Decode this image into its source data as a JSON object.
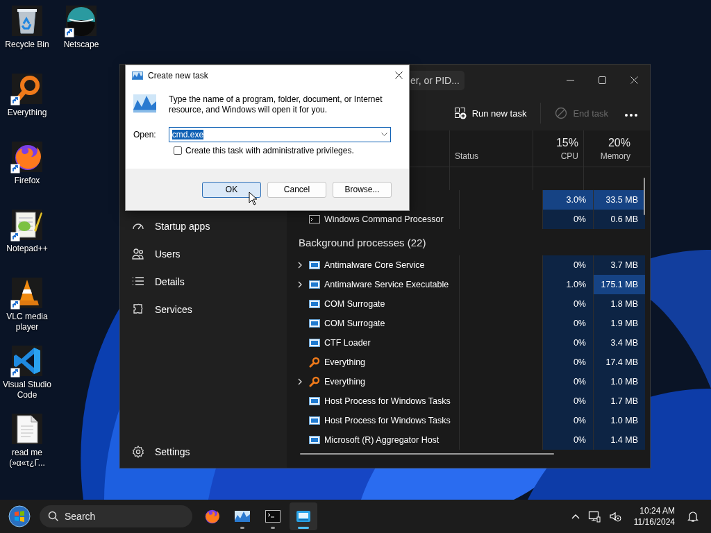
{
  "desktop": {
    "columns": [
      [
        {
          "label": "Recycle Bin",
          "kind": "recycle-bin",
          "shortcut": false
        },
        {
          "label": "Everything",
          "kind": "everything",
          "shortcut": true
        },
        {
          "label": "Firefox",
          "kind": "firefox",
          "shortcut": true
        },
        {
          "label": "Notepad++",
          "kind": "notepad",
          "shortcut": true
        },
        {
          "label": "VLC media player",
          "kind": "vlc",
          "shortcut": true
        },
        {
          "label": "Visual Studio Code",
          "kind": "vscode",
          "shortcut": true
        },
        {
          "label": "read me (»α«τ¿Γ...",
          "kind": "document",
          "shortcut": false
        }
      ],
      [
        {
          "label": "Netscape",
          "kind": "netscape",
          "shortcut": true
        }
      ]
    ]
  },
  "task_manager": {
    "search": {
      "placeholder": "er, or PID..."
    },
    "toolbar": [
      {
        "label": "Run new task",
        "kind": "run",
        "disabled": false
      },
      {
        "label": "End task",
        "kind": "end",
        "disabled": true
      }
    ],
    "sidebar": {
      "items": [
        {
          "label": "Startup apps",
          "kind": "startup"
        },
        {
          "label": "Users",
          "kind": "users"
        },
        {
          "label": "Details",
          "kind": "details"
        },
        {
          "label": "Services",
          "kind": "services"
        }
      ],
      "footer": {
        "label": "Settings",
        "kind": "settings"
      }
    },
    "columns": [
      {
        "kind": "status",
        "label": "Status"
      },
      {
        "kind": "cpu",
        "total": "15%",
        "label": "CPU"
      },
      {
        "kind": "memory",
        "total": "20%",
        "label": "Memory"
      }
    ],
    "apps_rows": [
      {
        "cpu": "3.0%",
        "memory": "33.5 MB",
        "cpu_hot": true,
        "memory_hot": true,
        "expandable": false
      },
      {
        "name": "Windows Command Processor",
        "kind": "console",
        "cpu": "0%",
        "memory": "0.6 MB",
        "cpu_hot": false,
        "memory_hot": false,
        "expandable": false
      }
    ],
    "background": {
      "title": "Background processes (22)",
      "rows": [
        {
          "name": "Antimalware Core Service",
          "kind": "service",
          "cpu": "0%",
          "memory": "3.7 MB",
          "cpu_hot": false,
          "memory_hot": false,
          "expandable": true
        },
        {
          "name": "Antimalware Service Executable",
          "kind": "service",
          "cpu": "1.0%",
          "memory": "175.1 MB",
          "cpu_hot": false,
          "memory_hot": true,
          "expandable": true
        },
        {
          "name": "COM Surrogate",
          "kind": "service",
          "cpu": "0%",
          "memory": "1.8 MB",
          "cpu_hot": false,
          "memory_hot": false,
          "expandable": false
        },
        {
          "name": "COM Surrogate",
          "kind": "service",
          "cpu": "0%",
          "memory": "1.9 MB",
          "cpu_hot": false,
          "memory_hot": false,
          "expandable": false
        },
        {
          "name": "CTF Loader",
          "kind": "service",
          "cpu": "0%",
          "memory": "3.4 MB",
          "cpu_hot": false,
          "memory_hot": false,
          "expandable": false
        },
        {
          "name": "Everything",
          "kind": "everything",
          "cpu": "0%",
          "memory": "17.4 MB",
          "cpu_hot": false,
          "memory_hot": false,
          "expandable": false
        },
        {
          "name": "Everything",
          "kind": "everything",
          "cpu": "0%",
          "memory": "1.0 MB",
          "cpu_hot": false,
          "memory_hot": false,
          "expandable": true
        },
        {
          "name": "Host Process for Windows Tasks",
          "kind": "service",
          "cpu": "0%",
          "memory": "1.7 MB",
          "cpu_hot": false,
          "memory_hot": false,
          "expandable": false
        },
        {
          "name": "Host Process for Windows Tasks",
          "kind": "service",
          "cpu": "0%",
          "memory": "1.0 MB",
          "cpu_hot": false,
          "memory_hot": false,
          "expandable": false
        },
        {
          "name": "Microsoft (R) Aggregator Host",
          "kind": "service",
          "cpu": "0%",
          "memory": "1.4 MB",
          "cpu_hot": false,
          "memory_hot": false,
          "expandable": false
        }
      ]
    }
  },
  "dialog": {
    "title": "Create new task",
    "message": "Type the name of a program, folder, document, or Internet resource, and Windows will open it for you.",
    "open_label": "Open:",
    "value": "cmd.exe",
    "value_selected": true,
    "checkbox": {
      "label": "Create this task with administrative privileges.",
      "checked": false
    },
    "buttons": [
      {
        "label": "OK",
        "default": true
      },
      {
        "label": "Cancel",
        "default": false
      },
      {
        "label": "Browse...",
        "default": false
      }
    ]
  },
  "taskbar": {
    "search": {
      "placeholder": "Search"
    },
    "apps": [
      {
        "kind": "firefox",
        "running": false,
        "active": false
      },
      {
        "kind": "taskmgr",
        "running": true,
        "active": false
      },
      {
        "kind": "terminal",
        "running": true,
        "active": false
      },
      {
        "kind": "run",
        "running": true,
        "active": true
      }
    ],
    "time": "10:24 AM",
    "date": "11/16/2024"
  }
}
